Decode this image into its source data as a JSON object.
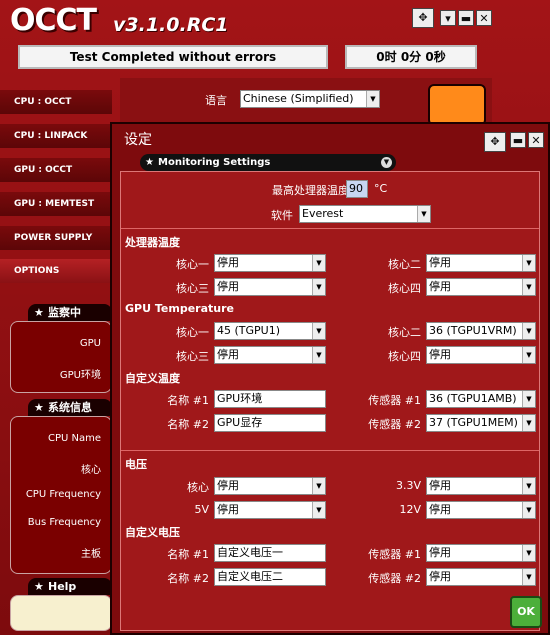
{
  "app": {
    "logo": "OCCT",
    "version": "v3.1.0.RC1"
  },
  "status": {
    "message": "Test Completed without errors",
    "timer": "0时 0分 0秒"
  },
  "tabs": [
    "CPU : OCCT",
    "CPU : LINPACK",
    "GPU : OCCT",
    "GPU : MEMTEST",
    "POWER SUPPLY",
    "OPTIONS"
  ],
  "language": {
    "label": "语言",
    "value": "Chinese (Simplified)"
  },
  "monitor_panel": {
    "title": "监察中",
    "items": [
      "GPU",
      "GPU环境"
    ]
  },
  "sysinfo_panel": {
    "title": "系统信息",
    "items": [
      "CPU Name",
      "核心",
      "CPU Frequency",
      "Bus Frequency",
      "主板"
    ]
  },
  "help_panel": {
    "title": "Help"
  },
  "dialog": {
    "title": "设定",
    "section": "Monitoring Settings",
    "max_temp": {
      "label": "最高处理器温度",
      "value": "90",
      "unit": "°C"
    },
    "software": {
      "label": "软件",
      "value": "Everest"
    },
    "cpu_temp": {
      "title": "处理器温度",
      "core1": {
        "label": "核心一",
        "value": "停用"
      },
      "core2": {
        "label": "核心二",
        "value": "停用"
      },
      "core3": {
        "label": "核心三",
        "value": "停用"
      },
      "core4": {
        "label": "核心四",
        "value": "停用"
      }
    },
    "gpu_temp": {
      "title": "GPU Temperature",
      "core1": {
        "label": "核心一",
        "value": "45 (TGPU1)"
      },
      "core2": {
        "label": "核心二",
        "value": "36 (TGPU1VRM)"
      },
      "core3": {
        "label": "核心三",
        "value": "停用"
      },
      "core4": {
        "label": "核心四",
        "value": "停用"
      }
    },
    "custom_temp": {
      "title": "自定义温度",
      "name1": {
        "label": "名称 #1",
        "value": "GPU环境"
      },
      "sensor1": {
        "label": "传感器 #1",
        "value": "36 (TGPU1AMB)"
      },
      "name2": {
        "label": "名称 #2",
        "value": "GPU显存"
      },
      "sensor2": {
        "label": "传感器 #2",
        "value": "37 (TGPU1MEM)"
      }
    },
    "voltage": {
      "title": "电压",
      "core": {
        "label": "核心",
        "value": "停用"
      },
      "v33": {
        "label": "3.3V",
        "value": "停用"
      },
      "v5": {
        "label": "5V",
        "value": "停用"
      },
      "v12": {
        "label": "12V",
        "value": "停用"
      }
    },
    "custom_voltage": {
      "title": "自定义电压",
      "name1": {
        "label": "名称 #1",
        "value": "自定义电压一"
      },
      "sensor1": {
        "label": "传感器 #1",
        "value": "停用"
      },
      "name2": {
        "label": "名称 #2",
        "value": "自定义电压二"
      },
      "sensor2": {
        "label": "传感器 #2",
        "value": "停用"
      }
    },
    "ok": "OK"
  }
}
